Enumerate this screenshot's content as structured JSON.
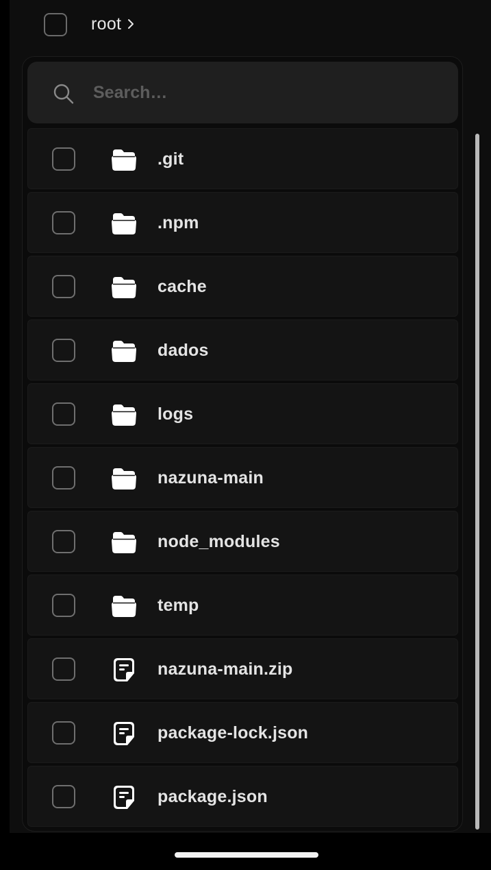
{
  "header": {
    "breadcrumb_label": "root",
    "breadcrumb_chevron_icon": "chevron-right-icon"
  },
  "search": {
    "placeholder": "Search…",
    "value": "",
    "icon": "search-icon"
  },
  "files": [
    {
      "name": ".git",
      "type": "folder",
      "icon": "folder-icon"
    },
    {
      "name": ".npm",
      "type": "folder",
      "icon": "folder-icon"
    },
    {
      "name": "cache",
      "type": "folder",
      "icon": "folder-icon"
    },
    {
      "name": "dados",
      "type": "folder",
      "icon": "folder-icon"
    },
    {
      "name": "logs",
      "type": "folder",
      "icon": "folder-icon"
    },
    {
      "name": "nazuna-main",
      "type": "folder",
      "icon": "folder-icon"
    },
    {
      "name": "node_modules",
      "type": "folder",
      "icon": "folder-icon"
    },
    {
      "name": "temp",
      "type": "folder",
      "icon": "folder-icon"
    },
    {
      "name": "nazuna-main.zip",
      "type": "file",
      "icon": "file-icon"
    },
    {
      "name": "package-lock.json",
      "type": "file",
      "icon": "file-icon"
    },
    {
      "name": "package.json",
      "type": "file",
      "icon": "file-icon"
    }
  ],
  "colors": {
    "background": "#0e0e0e",
    "row_background": "#141414",
    "search_background": "#1f1f1f",
    "text": "#e4e4e4",
    "placeholder": "#5d5d5d",
    "checkbox_border": "#6f6f6f",
    "scrollbar": "#b9b9b9"
  }
}
